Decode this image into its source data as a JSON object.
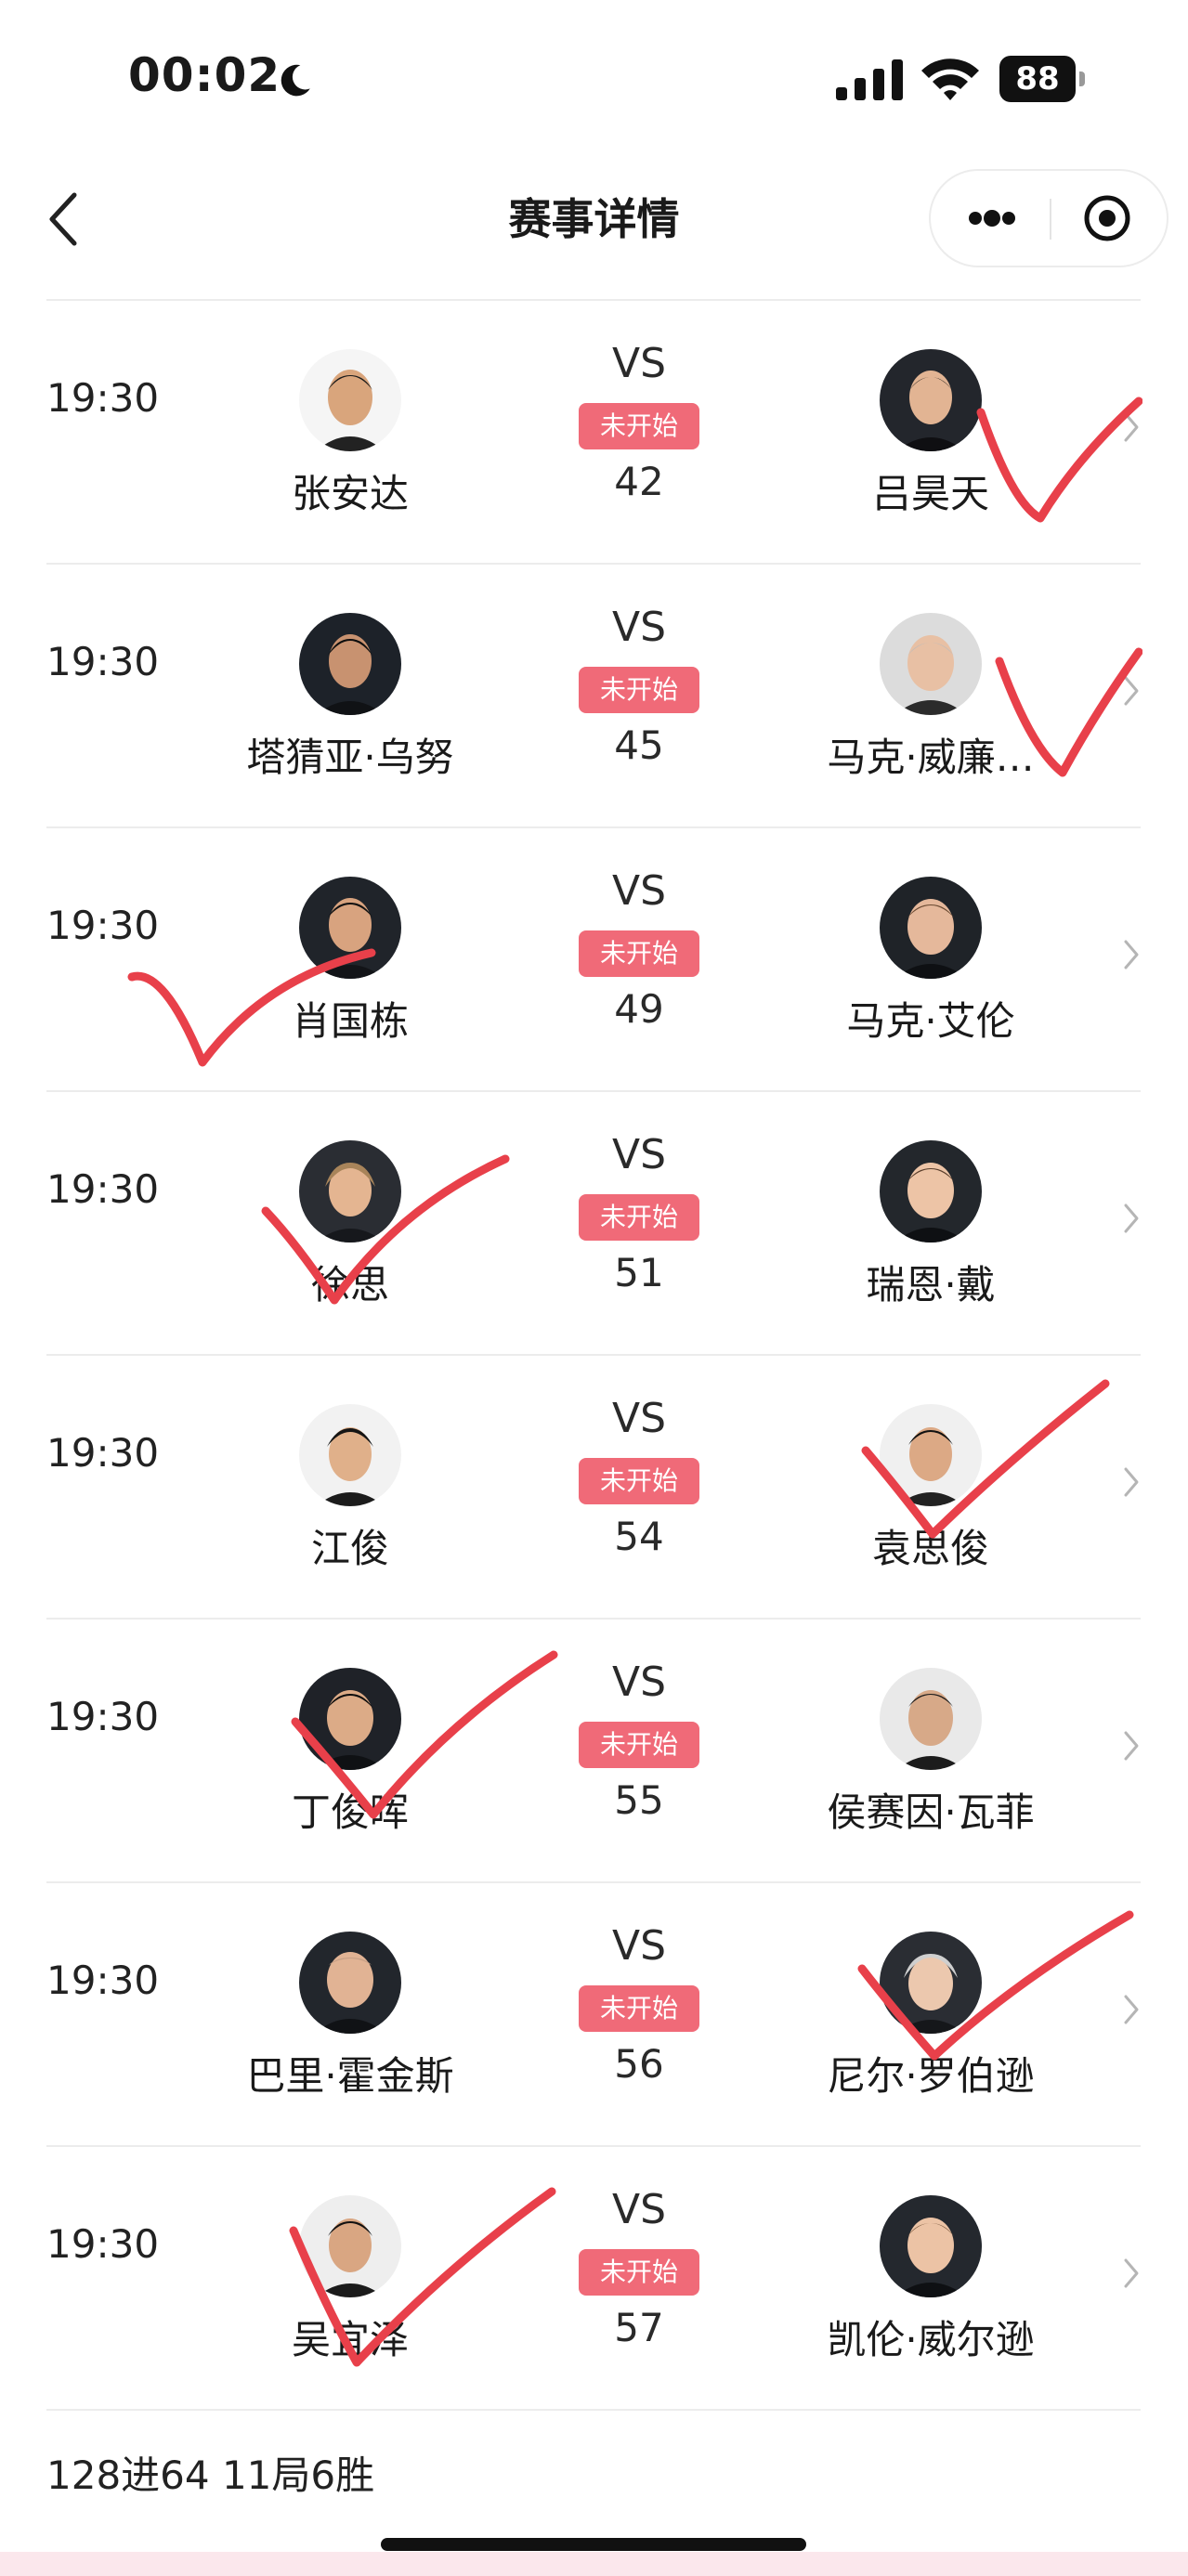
{
  "status_bar": {
    "time": "00:02",
    "battery": "88",
    "icons": [
      "moon-icon",
      "signal-icon",
      "wifi-icon",
      "battery-icon"
    ]
  },
  "nav": {
    "title": "赛事详情",
    "back_icon": "chevron-left-icon",
    "more_icon": "more-dots-icon",
    "close_icon": "target-circle-icon"
  },
  "colors": {
    "badge": "#f06a78",
    "check_mark": "#e8404a",
    "divider": "#ececec"
  },
  "matches": [
    {
      "time": "19:30",
      "left": "张安达",
      "right": "吕昊天",
      "vs": "VS",
      "status": "未开始",
      "number": "42",
      "checked": "right"
    },
    {
      "time": "19:30",
      "left": "塔猜亚·乌努",
      "right": "马克·威廉…",
      "vs": "VS",
      "status": "未开始",
      "number": "45",
      "checked": "right"
    },
    {
      "time": "19:30",
      "left": "肖国栋",
      "right": "马克·艾伦",
      "vs": "VS",
      "status": "未开始",
      "number": "49",
      "checked": "left"
    },
    {
      "time": "19:30",
      "left": "徐思",
      "right": "瑞恩·戴",
      "vs": "VS",
      "status": "未开始",
      "number": "51",
      "checked": "left"
    },
    {
      "time": "19:30",
      "left": "江俊",
      "right": "袁思俊",
      "vs": "VS",
      "status": "未开始",
      "number": "54",
      "checked": "right"
    },
    {
      "time": "19:30",
      "left": "丁俊晖",
      "right": "侯赛因·瓦菲",
      "vs": "VS",
      "status": "未开始",
      "number": "55",
      "checked": "left"
    },
    {
      "time": "19:30",
      "left": "巴里·霍金斯",
      "right": "尼尔·罗伯逊",
      "vs": "VS",
      "status": "未开始",
      "number": "56",
      "checked": "right"
    },
    {
      "time": "19:30",
      "left": "吴宜泽",
      "right": "凯伦·威尔逊",
      "vs": "VS",
      "status": "未开始",
      "number": "57",
      "checked": "left"
    }
  ],
  "footer": {
    "note": "128进64 11局6胜"
  }
}
